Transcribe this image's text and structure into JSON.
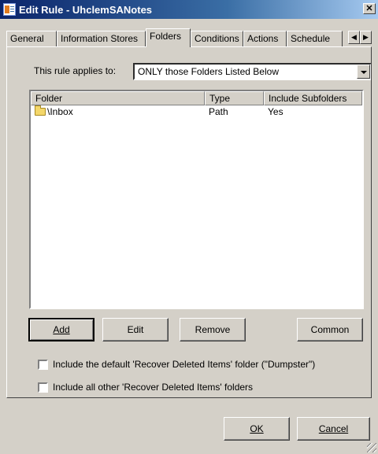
{
  "window": {
    "title": "Edit Rule - UhclemSANotes",
    "close_label": "✕"
  },
  "tabs": [
    {
      "label": "General"
    },
    {
      "label": "Information Stores"
    },
    {
      "label": "Folders"
    },
    {
      "label": "Conditions"
    },
    {
      "label": "Actions"
    },
    {
      "label": "Schedule"
    }
  ],
  "tab_scroll": {
    "left": "◀",
    "right": "▶"
  },
  "applies": {
    "label": "This rule applies to:",
    "value": "ONLY those Folders Listed Below"
  },
  "list": {
    "columns": [
      "Folder",
      "Type",
      "Include Subfolders"
    ],
    "rows": [
      {
        "folder": "\\Inbox",
        "type": "Path",
        "subfolders": "Yes"
      }
    ]
  },
  "buttons": {
    "add": "Add",
    "edit": "Edit",
    "remove": "Remove",
    "common": "Common",
    "ok": "OK",
    "cancel": "Cancel"
  },
  "checkboxes": {
    "dumpster": {
      "label": "Include the default 'Recover Deleted Items' folder (\"Dumpster\")",
      "checked": false
    },
    "other": {
      "label": "Include all other 'Recover Deleted Items' folders",
      "checked": false
    }
  }
}
